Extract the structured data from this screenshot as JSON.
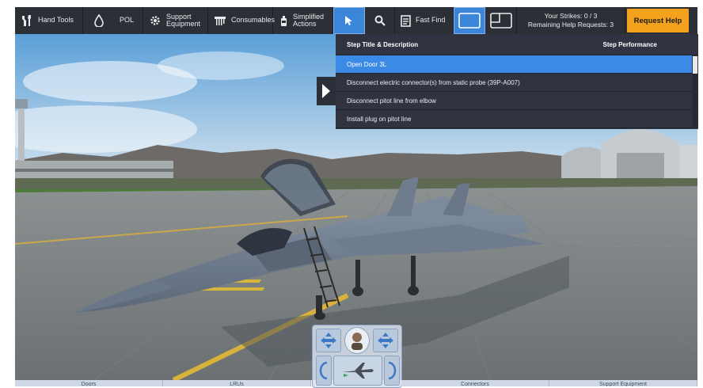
{
  "toolbar": {
    "hand_tools": "Hand Tools",
    "pol": "POL",
    "support_equipment_line1": "Support",
    "support_equipment_line2": "Equipment",
    "consumables": "Consumables",
    "simplified_actions_line1": "Simplified",
    "simplified_actions_line2": "Actions",
    "fast_find": "Fast Find",
    "strikes": "Your Strikes: 0 / 3",
    "help_requests": "Remaining Help Requests: 3",
    "request_help": "Request Help"
  },
  "steps": {
    "header_title": "Step Title & Description",
    "header_performance": "Step Performance",
    "rows": [
      "Open Door 3L",
      "Disconnect electric connector(s) from static probe (39P-A007)",
      "Disconnect pitot line from elbow",
      "Install plug on pitot line"
    ]
  },
  "bottom_tabs": [
    "Doors",
    "LRUs",
    "",
    "Connectors",
    "Support Equipment"
  ],
  "colors": {
    "toolbar_bg": "#2c2f35",
    "accent_blue": "#3b86d8",
    "request_help": "#f4a11d",
    "panel_bg": "#2f3440",
    "selected_row": "#3b8ae6"
  },
  "icons": [
    "wrench-screwdriver-icon",
    "drop-icon",
    "gear-icon",
    "brush-icon",
    "spray-can-icon",
    "cursor-arrow-icon",
    "magnifier-icon",
    "document-icon",
    "single-view-icon",
    "split-view-icon",
    "play-right-icon"
  ]
}
